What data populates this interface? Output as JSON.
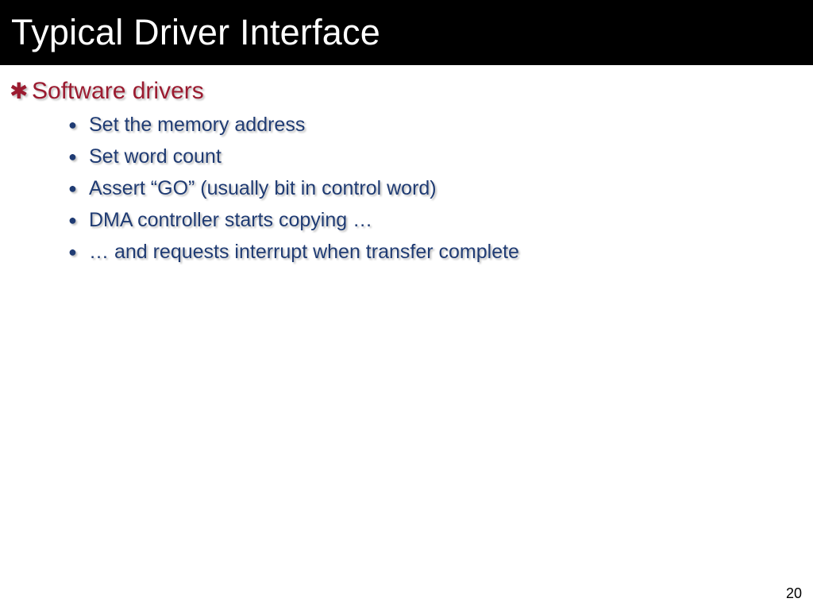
{
  "title": "Typical Driver Interface",
  "headline": "Software drivers",
  "bullets": [
    "Set the memory address",
    "Set word count",
    "Assert “GO” (usually bit in control word)",
    "DMA controller starts copying …",
    "… and requests interrupt when transfer complete"
  ],
  "page_number": "20"
}
